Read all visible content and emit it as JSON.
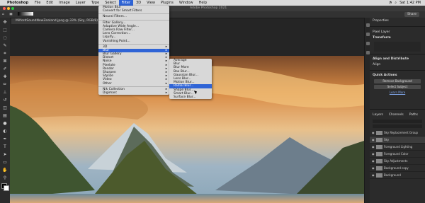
{
  "menubar": {
    "apple": "",
    "app": "Photoshop",
    "items": [
      "File",
      "Edit",
      "Image",
      "Layer",
      "Type",
      "Select",
      "Filter",
      "3D",
      "View",
      "Plugins",
      "Window",
      "Help"
    ],
    "active_index": 6,
    "right_items": [
      "Sat 1:42 PM"
    ]
  },
  "window": {
    "title": "Adobe Photoshop 2021"
  },
  "options": {
    "share": "Share"
  },
  "document": {
    "tab": "MilfordSoundNewZealand.jpeg @ 33% (Sky, RGB/8)"
  },
  "filter_menu": {
    "items": [
      {
        "label": "Motion Blur",
        "type": "item"
      },
      {
        "label": "Convert for Smart Filters",
        "type": "item"
      },
      {
        "type": "sep"
      },
      {
        "label": "Neural Filters...",
        "type": "item"
      },
      {
        "type": "sep"
      },
      {
        "label": "Filter Gallery...",
        "type": "item"
      },
      {
        "label": "Adaptive Wide Angle...",
        "type": "item"
      },
      {
        "label": "Camera Raw Filter...",
        "type": "item"
      },
      {
        "label": "Lens Correction...",
        "type": "item"
      },
      {
        "label": "Liquify...",
        "type": "item"
      },
      {
        "label": "Vanishing Point...",
        "type": "item"
      },
      {
        "type": "sep"
      },
      {
        "label": "3D",
        "type": "sub"
      },
      {
        "label": "Blur",
        "type": "sub",
        "hi": true
      },
      {
        "label": "Blur Gallery",
        "type": "sub"
      },
      {
        "label": "Distort",
        "type": "sub"
      },
      {
        "label": "Noise",
        "type": "sub"
      },
      {
        "label": "Pixelate",
        "type": "sub"
      },
      {
        "label": "Render",
        "type": "sub"
      },
      {
        "label": "Sharpen",
        "type": "sub"
      },
      {
        "label": "Stylize",
        "type": "sub"
      },
      {
        "label": "Video",
        "type": "sub"
      },
      {
        "label": "Other",
        "type": "sub"
      },
      {
        "type": "sep"
      },
      {
        "label": "Nik Collection",
        "type": "sub"
      },
      {
        "label": "Digimarc",
        "type": "sub"
      }
    ]
  },
  "blur_menu": {
    "items": [
      {
        "label": "Average"
      },
      {
        "label": "Blur"
      },
      {
        "label": "Blur More"
      },
      {
        "label": "Box Blur..."
      },
      {
        "label": "Gaussian Blur..."
      },
      {
        "label": "Lens Blur..."
      },
      {
        "label": "Motion Blur..."
      },
      {
        "label": "Radial Blur...",
        "hi": true
      },
      {
        "label": "Shape Blur..."
      },
      {
        "label": "Smart Blur..."
      },
      {
        "label": "Surface Blur..."
      }
    ]
  },
  "panels": {
    "tabs": [
      "Properties"
    ],
    "layer_label": "Pixel Layer",
    "transform": "Transform",
    "align": "Align and Distribute",
    "align_sub": "Align",
    "quick_actions": "Quick Actions",
    "remove_bg": "Remove Background",
    "select_subject": "Select Subject",
    "learn_more": "Learn More",
    "layer_tabs": [
      "Layers",
      "Channels",
      "Paths"
    ],
    "layers": [
      {
        "name": "Sky Replacement Group",
        "sel": false
      },
      {
        "name": "Sky",
        "sel": true
      },
      {
        "name": "Foreground Lighting",
        "sel": false
      },
      {
        "name": "Foreground Color",
        "sel": false
      },
      {
        "name": "Sky Adjustments",
        "sel": false
      },
      {
        "name": "Background copy",
        "sel": false
      },
      {
        "name": "Background",
        "sel": false
      }
    ]
  },
  "colors": {
    "accent": "#2f64d6",
    "menu_bg": "#d8d8d8",
    "app_bg": "#1e1e1e"
  }
}
